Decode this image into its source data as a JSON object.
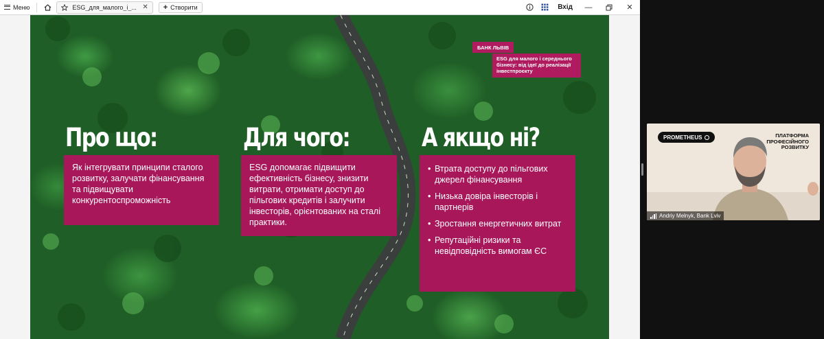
{
  "titlebar": {
    "menu_label": "Меню",
    "tab_title": "ESG_для_малого_і_...",
    "new_tab_label": "Створити",
    "login_label": "Вхід"
  },
  "slide": {
    "tag": "БАНК ЛЬВІВ",
    "subtitle": "ESG для малого і середнього бізнесу: від ідеї до реалізації інвестпроєкту",
    "columns": [
      {
        "heading": "Про що:",
        "text": "Як інтегрувати принципи сталого розвитку, залучати фінансування та підвищувати конкурентоспроможність"
      },
      {
        "heading": "Для чого:",
        "text": "ESG допомагає підвищити ефективність бізнесу, знизити витрати, отримати доступ до пільгових кредитів і залучити інвесторів, орієнтованих на сталі практики."
      },
      {
        "heading": "А якщо ні?",
        "bullets": [
          "Втрата доступу до пільгових джерел фінансування",
          "Низька довіра інвесторів і партнерів",
          "Зростання енергетичних витрат",
          "Репутаційні ризики та невідповідність вимогам ЄС"
        ]
      }
    ]
  },
  "video": {
    "brand": "PROMETHEUS",
    "platform": "ПЛАТФОРМА ПРОФЕСІЙНОГО РОЗВИТКУ",
    "participant": "Andriy Melnyk, Bank Lviv"
  },
  "colors": {
    "accent": "#a8175a",
    "forest": "#1f5e26"
  }
}
